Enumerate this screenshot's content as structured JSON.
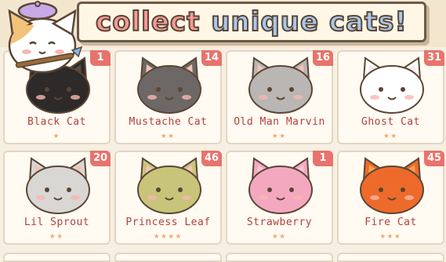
{
  "header": {
    "title_word1": "collect",
    "title_word2": "unique cats!"
  },
  "cats": [
    {
      "name": "Black Cat",
      "count": "1",
      "stars": 1,
      "fur": "#2d2a29",
      "inner": "#5a4a48"
    },
    {
      "name": "Mustache Cat",
      "count": "14",
      "stars": 2,
      "fur": "#6d6865",
      "inner": "#f2c4b6"
    },
    {
      "name": "Old Man Marvin",
      "count": "16",
      "stars": 2,
      "fur": "#b9b6b3",
      "inner": "#f2c4b6"
    },
    {
      "name": "Ghost Cat",
      "count": "31",
      "stars": 2,
      "fur": "#ffffff",
      "inner": "#f2e9ef"
    },
    {
      "name": "Lil Sprout",
      "count": "20",
      "stars": 2,
      "fur": "#d8d7d4",
      "inner": "#f2c4b6"
    },
    {
      "name": "Princess Leaf",
      "count": "46",
      "stars": 4,
      "fur": "#c8c47a",
      "inner": "#f2c4b6"
    },
    {
      "name": "Strawberry",
      "count": "1",
      "stars": 2,
      "fur": "#f4a8c0",
      "inner": "#f7c6d6"
    },
    {
      "name": "Fire Cat",
      "count": "45",
      "stars": 3,
      "fur": "#ee6a2a",
      "inner": "#f7a24a"
    }
  ],
  "star_char": "★"
}
